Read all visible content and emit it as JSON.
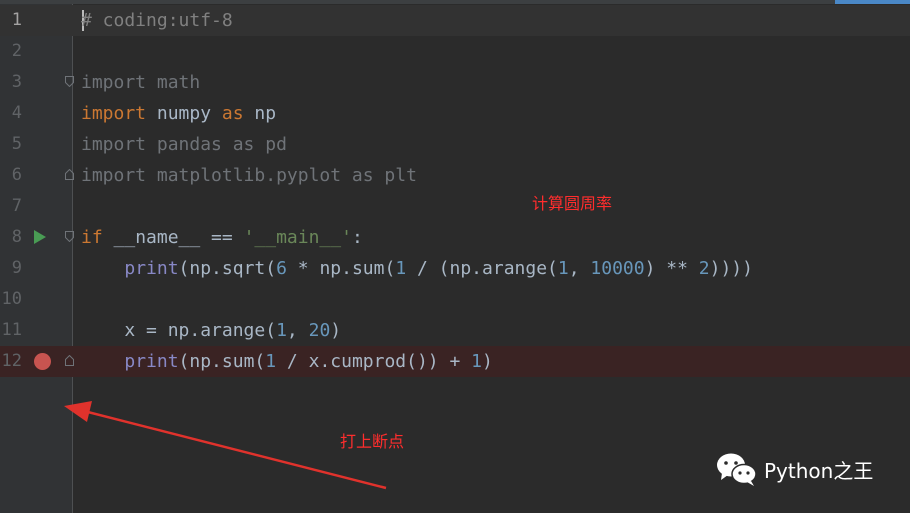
{
  "editor": {
    "lines": [
      {
        "n": "1",
        "segs": [
          {
            "t": "# coding:utf-8",
            "c": "cm"
          }
        ]
      },
      {
        "n": "2",
        "segs": []
      },
      {
        "n": "3",
        "segs": [
          {
            "t": "import math",
            "c": "dim"
          }
        ]
      },
      {
        "n": "4",
        "segs": [
          {
            "t": "import",
            "c": "kw"
          },
          {
            "t": " numpy ",
            "c": ""
          },
          {
            "t": "as",
            "c": "kw"
          },
          {
            "t": " np",
            "c": ""
          }
        ]
      },
      {
        "n": "5",
        "segs": [
          {
            "t": "import pandas as pd",
            "c": "dim"
          }
        ]
      },
      {
        "n": "6",
        "segs": [
          {
            "t": "import matplotlib.pyplot as plt",
            "c": "dim"
          }
        ]
      },
      {
        "n": "7",
        "segs": []
      },
      {
        "n": "8",
        "segs": [
          {
            "t": "if",
            "c": "kw"
          },
          {
            "t": " __name__ == ",
            "c": ""
          },
          {
            "t": "'__main__'",
            "c": "str"
          },
          {
            "t": ":",
            "c": ""
          }
        ]
      },
      {
        "n": "9",
        "segs": [
          {
            "t": "    ",
            "c": ""
          },
          {
            "t": "print",
            "c": "bi"
          },
          {
            "t": "(np.sqrt(",
            "c": ""
          },
          {
            "t": "6",
            "c": "num"
          },
          {
            "t": " * np.sum(",
            "c": ""
          },
          {
            "t": "1",
            "c": "num"
          },
          {
            "t": " / (np.arange(",
            "c": ""
          },
          {
            "t": "1",
            "c": "num"
          },
          {
            "t": ", ",
            "c": ""
          },
          {
            "t": "10000",
            "c": "num"
          },
          {
            "t": ") ** ",
            "c": ""
          },
          {
            "t": "2",
            "c": "num"
          },
          {
            "t": "))))",
            "c": ""
          }
        ]
      },
      {
        "n": "10",
        "segs": []
      },
      {
        "n": "11",
        "segs": [
          {
            "t": "    x = np.arange(",
            "c": ""
          },
          {
            "t": "1",
            "c": "num"
          },
          {
            "t": ", ",
            "c": ""
          },
          {
            "t": "20",
            "c": "num"
          },
          {
            "t": ")",
            "c": ""
          }
        ]
      },
      {
        "n": "12",
        "segs": [
          {
            "t": "    ",
            "c": ""
          },
          {
            "t": "print",
            "c": "bi"
          },
          {
            "t": "(np.sum(",
            "c": ""
          },
          {
            "t": "1",
            "c": "num"
          },
          {
            "t": " / x.cumprod()) + ",
            "c": ""
          },
          {
            "t": "1",
            "c": "num"
          },
          {
            "t": ")",
            "c": ""
          }
        ]
      }
    ]
  },
  "annotations": {
    "pi_note": "计算圆周率",
    "breakpoint_note": "打上断点"
  },
  "watermark": {
    "text": "Python之王",
    "icon": "wechat-icon"
  },
  "colors": {
    "keyword": "#cc7832",
    "string": "#6a8759",
    "number": "#6897bb",
    "builtin": "#8888c6",
    "comment": "#808080",
    "breakpoint": "#c75450",
    "run": "#499c54",
    "annotation": "#ff2d2d"
  }
}
